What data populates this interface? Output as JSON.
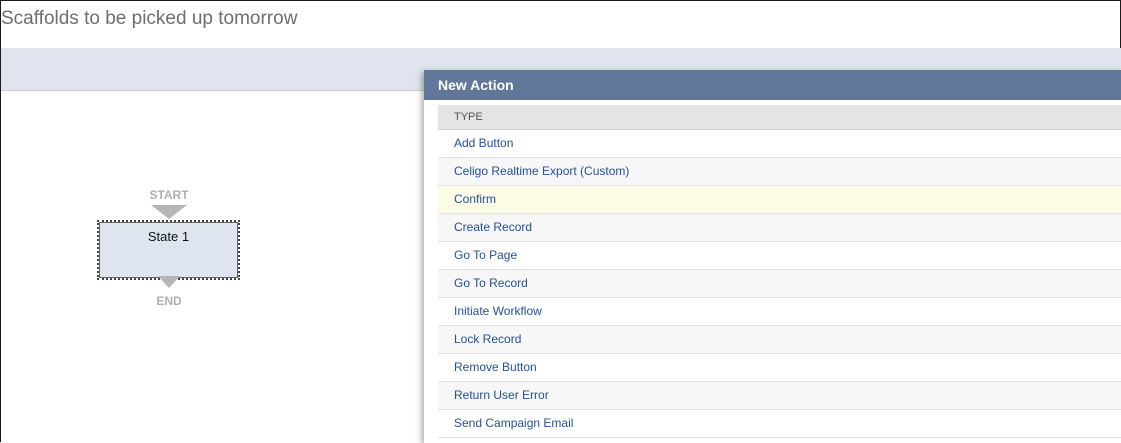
{
  "page": {
    "title": "Scaffolds to be picked up tomorrow"
  },
  "workflow": {
    "start_label": "START",
    "end_label": "END",
    "state_name": "State 1"
  },
  "dialog": {
    "title": "New Action",
    "column_header": "TYPE",
    "items": [
      {
        "label": "Add Button"
      },
      {
        "label": "Celigo Realtime Export (Custom)"
      },
      {
        "label": "Confirm"
      },
      {
        "label": "Create Record"
      },
      {
        "label": "Go To Page"
      },
      {
        "label": "Go To Record"
      },
      {
        "label": "Initiate Workflow"
      },
      {
        "label": "Lock Record"
      },
      {
        "label": "Remove Button"
      },
      {
        "label": "Return User Error"
      },
      {
        "label": "Send Campaign Email"
      }
    ]
  }
}
